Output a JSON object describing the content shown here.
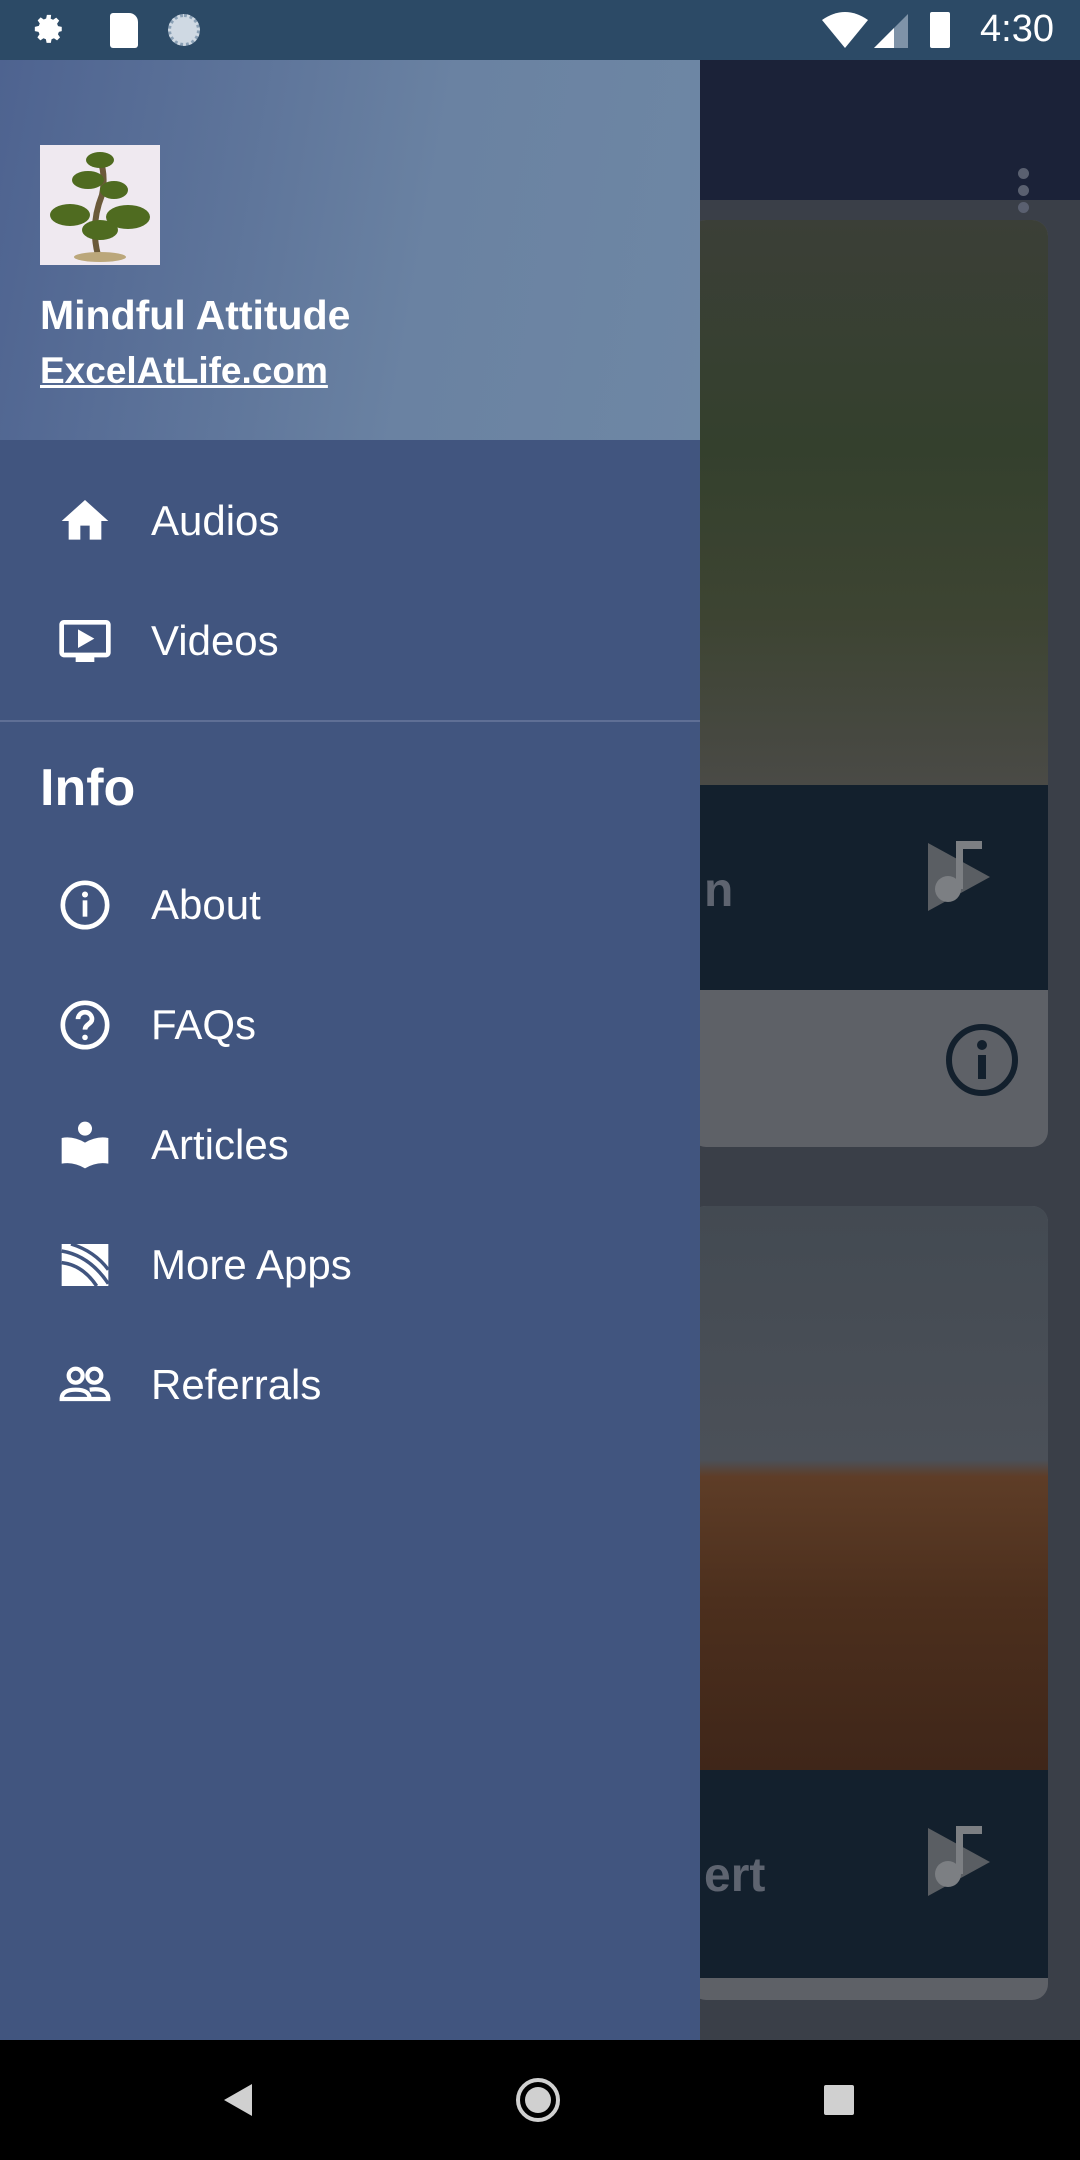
{
  "status_bar": {
    "time": "4:30",
    "icons": [
      "settings-icon",
      "sd-card-icon",
      "sync-icon",
      "wifi-icon",
      "signal-icon",
      "battery-icon"
    ]
  },
  "background": {
    "cards": [
      {
        "partial_title": "n",
        "icon": "music-play-icon",
        "info_icon": "info-icon"
      },
      {
        "partial_title": "ert",
        "icon": "music-play-icon"
      }
    ],
    "overflow_menu": "more-vert-icon"
  },
  "drawer": {
    "app_title": "Mindful Attitude",
    "app_link": "ExcelAtLife.com",
    "items": [
      {
        "label": "Audios",
        "icon": "home-icon"
      },
      {
        "label": "Videos",
        "icon": "tv-play-icon"
      }
    ],
    "section_title": "Info",
    "info_items": [
      {
        "label": "About",
        "icon": "info-icon"
      },
      {
        "label": "FAQs",
        "icon": "help-icon"
      },
      {
        "label": "Articles",
        "icon": "reader-icon"
      },
      {
        "label": "More Apps",
        "icon": "apps-icon"
      },
      {
        "label": "Referrals",
        "icon": "people-icon"
      }
    ]
  },
  "colors": {
    "drawer": "#41557f",
    "status": "#2c4a66",
    "appbar": "#1b2238"
  }
}
